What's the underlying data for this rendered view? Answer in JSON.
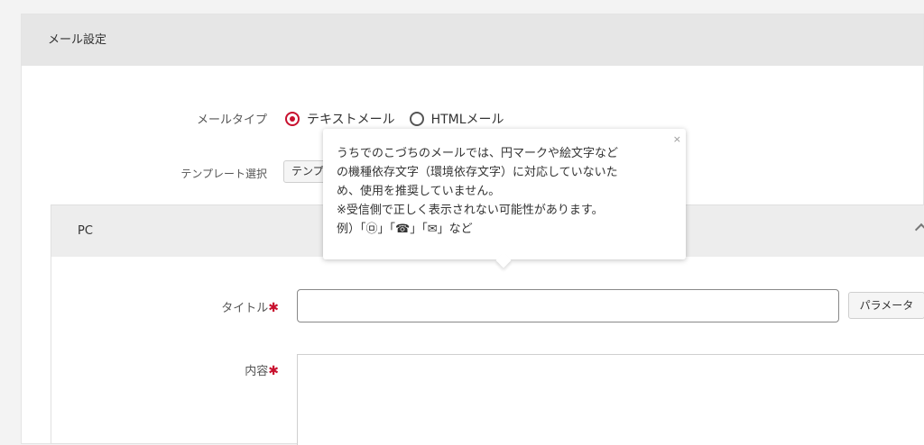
{
  "mail_settings": {
    "title": "メール設定"
  },
  "mail_type": {
    "label": "メールタイプ",
    "options": [
      {
        "label": "テキストメール",
        "checked": true
      },
      {
        "label": "HTMLメール",
        "checked": false
      }
    ]
  },
  "template": {
    "label": "テンプレート選択",
    "button_label": "テンプ"
  },
  "pc": {
    "title": "PC"
  },
  "title_field": {
    "label": "タイトル",
    "required_mark": "✱",
    "value": "",
    "param_button": "パラメータ"
  },
  "content_field": {
    "label": "内容",
    "required_mark": "✱",
    "value": ""
  },
  "tooltip": {
    "close": "×",
    "lines": [
      "うちでのこづちのメールでは、円マークや絵文字など",
      "の機種依存文字（環境依存文字）に対応していないた",
      "め、使用を推奨していません。",
      "※受信側で正しく表示されない可能性があります。",
      "例）「㉤」「☎」「✉」など"
    ]
  },
  "colors": {
    "accent": "#c8102e",
    "header_bg": "#e6e6e6"
  }
}
